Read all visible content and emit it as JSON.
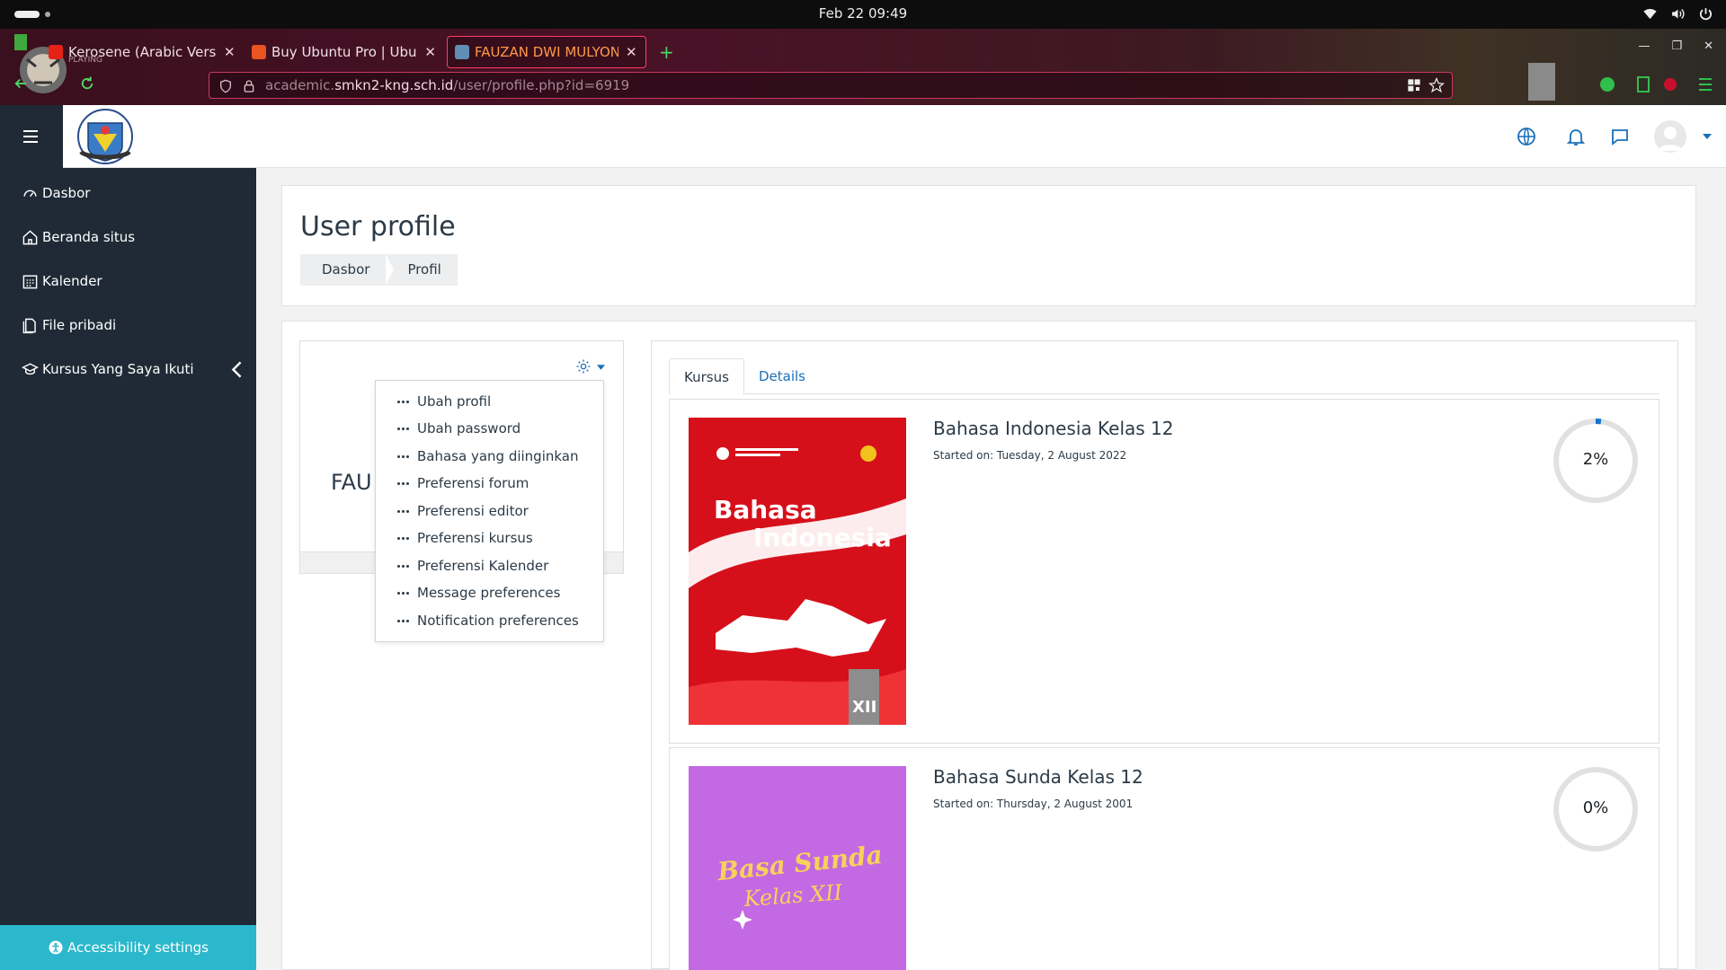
{
  "system": {
    "clock": "Feb 22  09:49"
  },
  "browser": {
    "tabs": [
      {
        "title": "Kerosene (Arabic Version)",
        "sub": "PLAYING",
        "active": false
      },
      {
        "title": "Buy Ubuntu Pro | Ubuntu",
        "active": false
      },
      {
        "title": "FAUZAN DWI MULYONO",
        "active": true
      }
    ],
    "url_prefix": "academic.",
    "url_domain": "smkn2-kng.sch.id",
    "url_path": "/user/profile.php?id=6919"
  },
  "sidebar": {
    "items": [
      {
        "label": "Dasbor",
        "icon": "dashboard-icon"
      },
      {
        "label": "Beranda situs",
        "icon": "home-icon"
      },
      {
        "label": "Kalender",
        "icon": "calendar-icon"
      },
      {
        "label": "File pribadi",
        "icon": "file-icon"
      },
      {
        "label": "Kursus Yang Saya Ikuti",
        "icon": "graduation-cap-icon"
      }
    ],
    "accessibility": "Accessibility settings"
  },
  "page": {
    "title": "User profile",
    "breadcrumb": [
      "Dasbor",
      "Profil"
    ]
  },
  "profile": {
    "name_partial": "FAU"
  },
  "dropdown": {
    "items": [
      "Ubah profil",
      "Ubah password",
      "Bahasa yang diinginkan",
      "Preferensi forum",
      "Preferensi editor",
      "Preferensi kursus",
      "Preferensi Kalender",
      "Message preferences",
      "Notification preferences"
    ]
  },
  "tabs": {
    "kursus": "Kursus",
    "details": "Details"
  },
  "courses": [
    {
      "title": "Bahasa Indonesia Kelas 12",
      "started": "Started on: Tuesday, 2 August 2022",
      "progress_label": "2%",
      "progress": 0.02,
      "cover_text_1": "Bahasa",
      "cover_text_2": "Indonesia",
      "cover_grade": "XII",
      "cover_color": "#d6101b"
    },
    {
      "title": "Bahasa Sunda Kelas 12",
      "started": "Started on: Thursday, 2 August 2001",
      "progress_label": "0%",
      "progress": 0.0,
      "cover_text_1": "Basa Sunda",
      "cover_text_2": "Kelas XII",
      "cover_color": "#c369e3"
    }
  ],
  "colors": {
    "sidebar_bg": "#1f2a36",
    "accent_link": "#1b6fb8",
    "accessibility_bg": "#2bb8cc",
    "progress_ring": "#e1e1e1",
    "progress_fill": "#1177d1"
  }
}
